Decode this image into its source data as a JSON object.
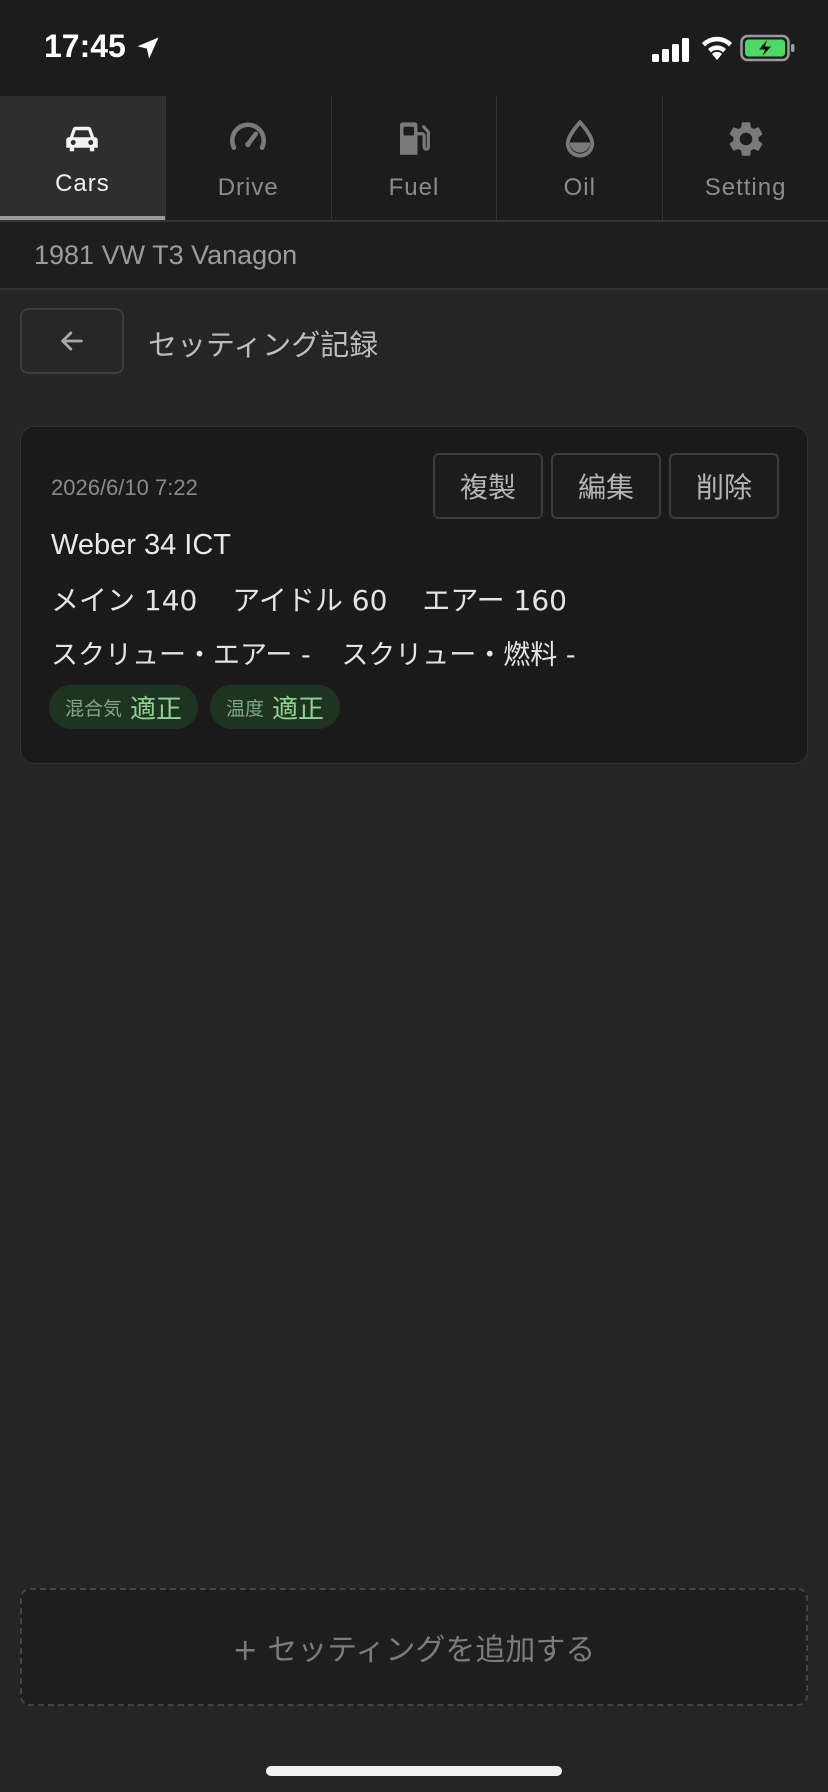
{
  "status": {
    "time": "17:45"
  },
  "tabs": [
    {
      "label": "Cars",
      "icon": "car-icon",
      "active": true
    },
    {
      "label": "Drive",
      "icon": "speedometer-icon",
      "active": false
    },
    {
      "label": "Fuel",
      "icon": "fuel-pump-icon",
      "active": false
    },
    {
      "label": "Oil",
      "icon": "oil-drop-icon",
      "active": false
    },
    {
      "label": "Setting",
      "icon": "gear-icon",
      "active": false
    }
  ],
  "vehicle": {
    "name": "1981 VW T3 Vanagon"
  },
  "header": {
    "title": "セッティング記録",
    "back_icon": "arrow-left-icon"
  },
  "record": {
    "date": "2026/6/10 7:22",
    "buttons": {
      "copy": "複製",
      "edit": "編集",
      "delete": "削除"
    },
    "carburetor": "Weber 34 ICT",
    "jets": {
      "main": "メイン 140",
      "idle": "アイドル 60",
      "air": "エアー 160"
    },
    "screws": {
      "air": "スクリュー・エアー -",
      "fuel": "スクリュー・燃料 -"
    },
    "badges": [
      {
        "label": "混合気",
        "value": "適正"
      },
      {
        "label": "温度",
        "value": "適正"
      }
    ]
  },
  "add_button": {
    "label": "+ セッティングを追加する"
  },
  "colors": {
    "background": "#252525",
    "card": "#1a1a1a",
    "badge_bg": "#1f3321",
    "badge_text": "#8fd694",
    "battery_charging": "#4cd964"
  }
}
